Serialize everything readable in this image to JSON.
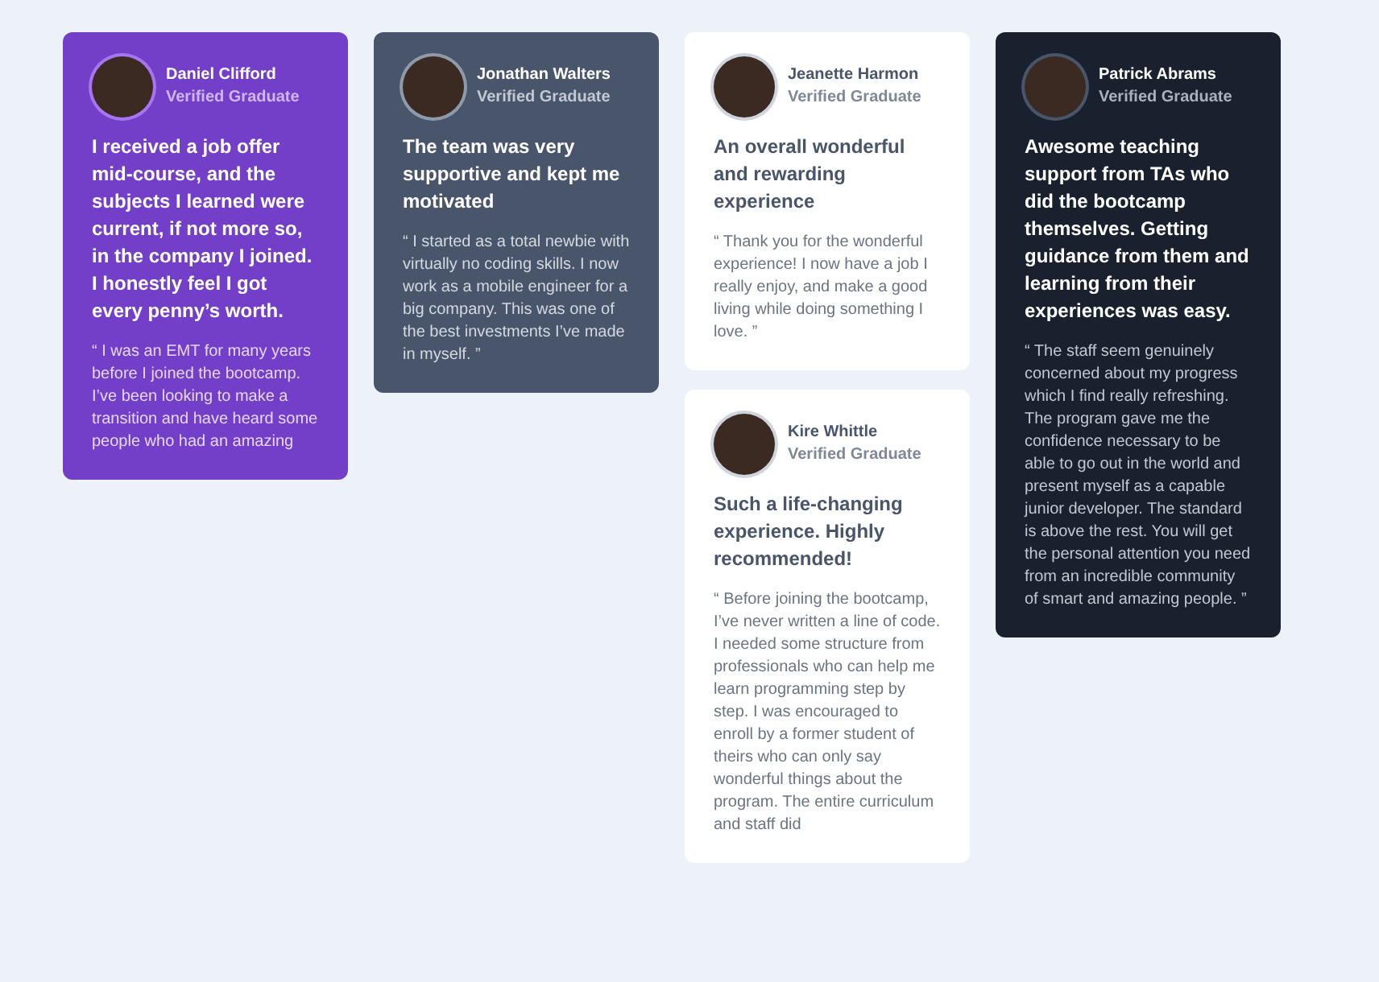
{
  "testimonials": [
    {
      "name": "Daniel Clifford",
      "role": "Verified Graduate",
      "color": "#733fc8",
      "headline": "I received a job offer mid-course, and the subjects I learned were current, if not more so, in the company I joined. I honestly feel I got every penny’s worth.",
      "quote": "“ I was an EMT for many years before I joined the bootcamp. I’ve been looking to make a transition and have heard some people who had an amazing"
    },
    {
      "name": "Jonathan Walters",
      "role": "Verified Graduate",
      "color": "#48556a",
      "headline": "The team was very supportive and kept me motivated",
      "quote": "“ I started as a total newbie with virtually no coding skills. I now work as a mobile engineer for a big company. This was one of the best investments I’ve made in myself. ”"
    },
    {
      "name": "Jeanette Harmon",
      "role": "Verified Graduate",
      "color": "#ffffff",
      "headline": "An overall wonderful and rewarding experience",
      "quote": "“ Thank you for the wonderful experience! I now have a job I really enjoy, and make a good living while doing something I love. ”"
    },
    {
      "name": "Patrick Abrams",
      "role": "Verified Graduate",
      "color": "#19212e",
      "headline": "Awesome teaching support from TAs who did the bootcamp themselves. Getting guidance from them and learning from their experiences was easy.",
      "quote": "“ The staff seem genuinely concerned about my progress which I find really refreshing. The program gave me the confidence necessary to be able to go out in the world and present myself as a capable junior developer. The standard is above the rest. You will get the personal attention you need from an incredible community of smart and amazing people. ”"
    },
    {
      "name": "Kire Whittle",
      "role": "Verified Graduate",
      "color": "#ffffff",
      "headline": "Such a life-changing experience. Highly recommended!",
      "quote": "“ Before joining the bootcamp, I’ve never written a line of code. I needed some structure from professionals who can help me learn programming step by step. I was encouraged to enroll by a former student of theirs who can only say wonderful things about the program. The entire curriculum and staff did"
    }
  ]
}
